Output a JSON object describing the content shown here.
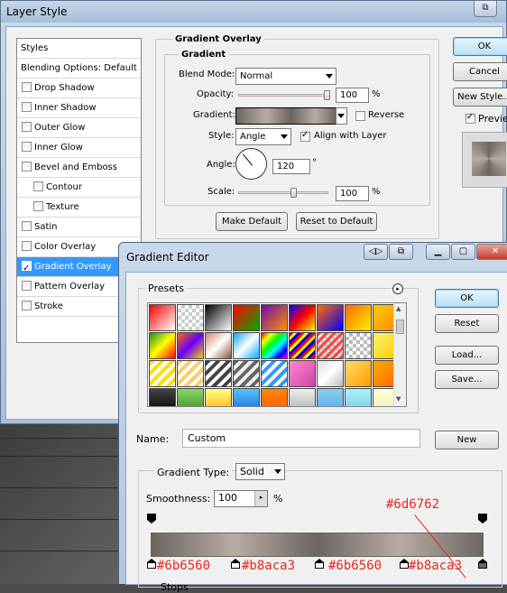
{
  "layer_style": {
    "title": "Layer Style",
    "styles_list": [
      {
        "label": "Styles",
        "type": "header"
      },
      {
        "label": "Blending Options: Default",
        "type": "header"
      },
      {
        "label": "Drop Shadow",
        "checked": false
      },
      {
        "label": "Inner Shadow",
        "checked": false
      },
      {
        "label": "Outer Glow",
        "checked": false
      },
      {
        "label": "Inner Glow",
        "checked": false
      },
      {
        "label": "Bevel and Emboss",
        "checked": false
      },
      {
        "label": "Contour",
        "checked": false,
        "sub": true
      },
      {
        "label": "Texture",
        "checked": false,
        "sub": true
      },
      {
        "label": "Satin",
        "checked": false
      },
      {
        "label": "Color Overlay",
        "checked": false
      },
      {
        "label": "Gradient Overlay",
        "checked": true,
        "selected": true
      },
      {
        "label": "Pattern Overlay",
        "checked": false
      },
      {
        "label": "Stroke",
        "checked": false
      }
    ],
    "section_title": "Gradient Overlay",
    "group_title": "Gradient",
    "blend_mode_label": "Blend Mode:",
    "blend_mode_value": "Normal",
    "opacity_label": "Opacity:",
    "opacity_value": "100",
    "opacity_unit": "%",
    "gradient_label": "Gradient:",
    "reverse_label": "Reverse",
    "style_label": "Style:",
    "style_value": "Angle",
    "align_label": "Align with Layer",
    "angle_label": "Angle:",
    "angle_value": "120",
    "angle_unit": "°",
    "scale_label": "Scale:",
    "scale_value": "100",
    "scale_unit": "%",
    "make_default": "Make Default",
    "reset_default": "Reset to Default",
    "ok": "OK",
    "cancel": "Cancel",
    "new_style": "New Style...",
    "preview": "Preview",
    "preview_checked": true
  },
  "gradient_editor": {
    "title": "Gradient Editor",
    "presets_label": "Presets",
    "ok": "OK",
    "reset": "Reset",
    "load": "Load...",
    "save": "Save...",
    "name_label": "Name:",
    "name_value": "Custom",
    "new_button": "New",
    "gradient_type_label": "Gradient Type:",
    "gradient_type_value": "Solid",
    "smoothness_label": "Smoothness:",
    "smoothness_value": "100",
    "smoothness_unit": "%",
    "stops_label": "Stops"
  },
  "annotations": {
    "top_right": "#6d6762",
    "stops": [
      "#6b6560",
      "#b8aca3",
      "#6b6560",
      "#b8aca3"
    ]
  },
  "colors": {
    "dark_metal": "#6b6560",
    "light_metal": "#b8aca3",
    "end_metal": "#6d6762",
    "annotation_red": "#e8281e",
    "selection_blue": "#3399ff"
  }
}
